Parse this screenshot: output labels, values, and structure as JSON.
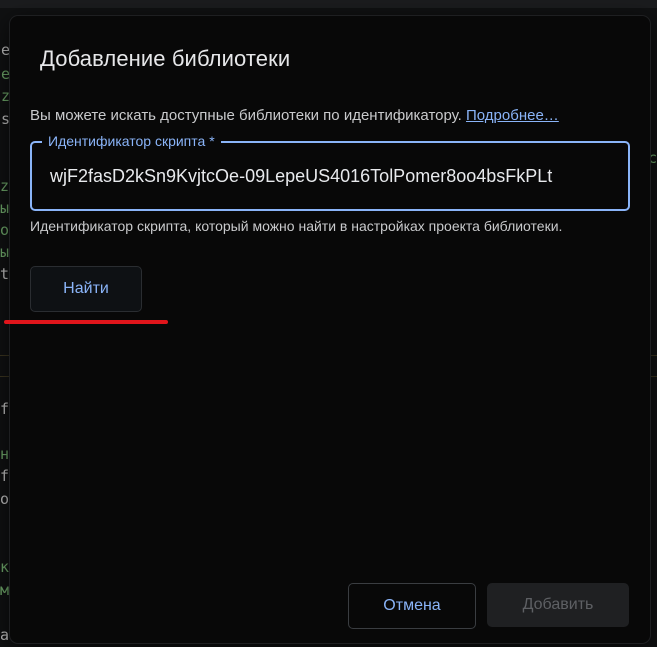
{
  "dialog": {
    "title": "Добавление библиотеки",
    "description": "Вы можете искать доступные библиотеки по идентификатору.",
    "learn_more_link": "Подробнее…",
    "field_label": "Идентификатор скрипта *",
    "field_value": "wjF2fasD2kSn9KvjtcOe-09LepeUS4016TolPomer8oo4bsFkPLt",
    "hint": "Идентификатор скрипта, который можно найти в настройках проекта библиотеки.",
    "find_button": "Найти",
    "cancel_button": "Отмена",
    "add_button": "Добавить"
  },
  "background": {
    "visible_chars": [
      "e",
      "e",
      "z",
      "s",
      "z",
      "ы",
      "o",
      "c",
      "ы",
      "t",
      "f",
      "н",
      "f",
      "o",
      "к",
      "м",
      "a"
    ]
  },
  "colors": {
    "accent": "#8ab4f8",
    "annotation_underline": "#e0151b",
    "dialog_bg": "#080808",
    "disabled_button_bg": "#1f2022"
  }
}
